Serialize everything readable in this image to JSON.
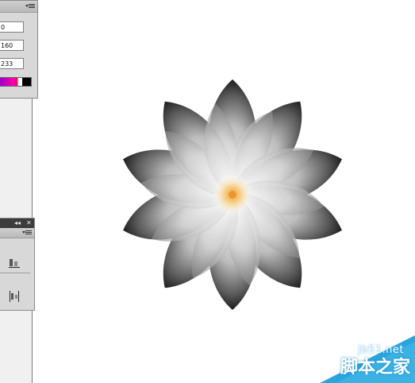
{
  "color_panel": {
    "field_1": "0",
    "field_2": "160",
    "field_3": "233"
  },
  "align_panel": {
    "collapse_glyph": "◂◂",
    "close_glyph": "✕"
  },
  "watermark": {
    "site": "jb51.net",
    "name": "脚本之家",
    "color": "#2aa4de"
  },
  "artwork": {
    "subject": "flower",
    "center_color": "#f0b25a"
  }
}
